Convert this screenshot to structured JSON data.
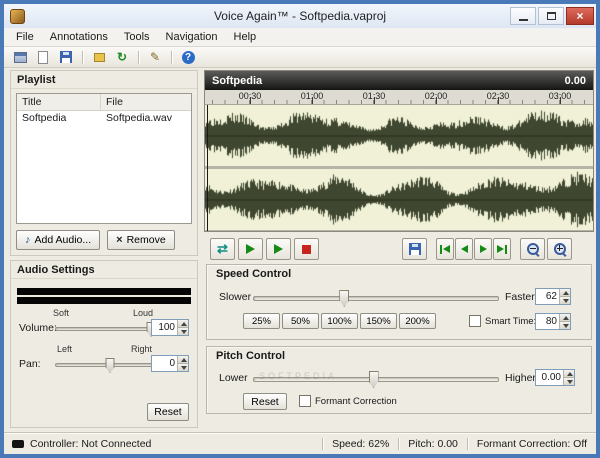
{
  "window": {
    "title": "Voice Again™ - Softpedia.vaproj",
    "close_glyph": "×"
  },
  "menu": {
    "items": [
      "File",
      "Annotations",
      "Tools",
      "Navigation",
      "Help"
    ]
  },
  "toolbar": {
    "refresh_glyph": "↻",
    "edit_glyph": "✎",
    "help_glyph": "?"
  },
  "playlist": {
    "header": "Playlist",
    "columns": {
      "title": "Title",
      "file": "File"
    },
    "rows": [
      {
        "title": "Softpedia",
        "file": "Softpedia.wav"
      }
    ],
    "add_button": "Add Audio...",
    "add_icon": "♪",
    "remove_button": "Remove",
    "remove_icon": "×"
  },
  "audio_settings": {
    "header": "Audio Settings",
    "volume_label": "Volume:",
    "soft_label": "Soft",
    "loud_label": "Loud",
    "volume_value": "100",
    "pan_label": "Pan:",
    "left_label": "Left",
    "right_label": "Right",
    "pan_value": "0",
    "reset_button": "Reset"
  },
  "waveform": {
    "title": "Softpedia",
    "position": "0.00",
    "ruler_labels": [
      "00:30",
      "01:00",
      "01:30",
      "02:00",
      "02:30",
      "03:00"
    ]
  },
  "transport": {
    "loop_glyph": "⇄"
  },
  "speed_control": {
    "header": "Speed Control",
    "slower_label": "Slower",
    "faster_label": "Faster",
    "value": "62",
    "presets": [
      "25%",
      "50%",
      "100%",
      "150%",
      "200%"
    ],
    "smart_time_label": "Smart Time:",
    "smart_time_value": "80"
  },
  "pitch_control": {
    "header": "Pitch Control",
    "lower_label": "Lower",
    "higher_label": "Higher",
    "value": "0.00",
    "reset_button": "Reset",
    "formant_label": "Formant Correction",
    "watermark": "SOFTPEDIA"
  },
  "status_bar": {
    "controller": "Controller: Not Connected",
    "speed": "Speed: 62%",
    "pitch": "Pitch: 0.00",
    "formant": "Formant Correction: Off"
  },
  "colors": {
    "frame_blue": "#4a79b8",
    "close_red": "#b33a2a",
    "wave_background": "#f0f1d6",
    "wave_ink": "#3f4730",
    "play_green": "#168a16",
    "stop_red": "#c8251c"
  }
}
